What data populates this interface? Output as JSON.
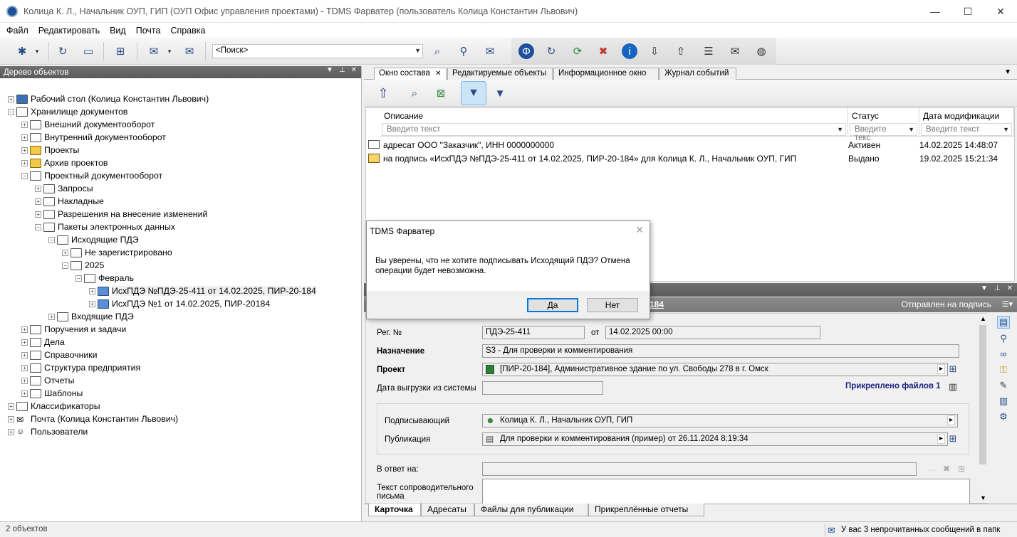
{
  "window": {
    "title": "Колица К. Л., Начальник ОУП, ГИП (ОУП Офис управления проектами) - TDMS Фарватер (пользователь Колица Константин Львович)",
    "minimize": "—",
    "maximize": "☐",
    "close": "✕"
  },
  "menu": [
    "Файл",
    "Редактировать",
    "Вид",
    "Почта",
    "Справка"
  ],
  "toolbar": {
    "search_value": "<Поиск>"
  },
  "tree_panel": {
    "title": "Дерево объектов",
    "items": [
      {
        "label": "Рабочий стол (Колица Константин Львович)",
        "level": 0,
        "sign": "+"
      },
      {
        "label": "Хранилище документов",
        "level": 0,
        "sign": "−"
      },
      {
        "label": "Внешний документооборот",
        "level": 1,
        "sign": "+"
      },
      {
        "label": "Внутренний документооборот",
        "level": 1,
        "sign": "+"
      },
      {
        "label": "Проекты",
        "level": 1,
        "sign": "+"
      },
      {
        "label": "Архив проектов",
        "level": 1,
        "sign": "+"
      },
      {
        "label": "Проектный документооборот",
        "level": 1,
        "sign": "−"
      },
      {
        "label": "Запросы",
        "level": 2,
        "sign": "+"
      },
      {
        "label": "Накладные",
        "level": 2,
        "sign": "+"
      },
      {
        "label": "Разрешения на внесение изменений",
        "level": 2,
        "sign": "+"
      },
      {
        "label": "Пакеты электронных данных",
        "level": 2,
        "sign": "−"
      },
      {
        "label": "Исходящие ПДЭ",
        "level": 3,
        "sign": "−"
      },
      {
        "label": "Не зарегистрировано",
        "level": 4,
        "sign": "+"
      },
      {
        "label": "2025",
        "level": 4,
        "sign": "−"
      },
      {
        "label": "Февраль",
        "level": 5,
        "sign": "−"
      },
      {
        "label": "ИсхПДЭ №ПДЭ-25-411 от 14.02.2025, ПИР-20-184",
        "level": 6,
        "sign": "+"
      },
      {
        "label": "ИсхПДЭ №1 от 14.02.2025, ПИР-20184",
        "level": 6,
        "sign": "+"
      },
      {
        "label": "Входящие ПДЭ",
        "level": 3,
        "sign": "+"
      },
      {
        "label": "Поручения и задачи",
        "level": 1,
        "sign": "+"
      },
      {
        "label": "Дела",
        "level": 1,
        "sign": "+"
      },
      {
        "label": "Справочники",
        "level": 1,
        "sign": "+"
      },
      {
        "label": "Структура предприятия",
        "level": 1,
        "sign": "+"
      },
      {
        "label": "Отчеты",
        "level": 1,
        "sign": "+"
      },
      {
        "label": "Шаблоны",
        "level": 1,
        "sign": "+"
      },
      {
        "label": "Классификаторы",
        "level": 0,
        "sign": "+"
      },
      {
        "label": "Почта (Колица Константин Львович)",
        "level": 0,
        "sign": "+"
      },
      {
        "label": "Пользователи",
        "level": 0,
        "sign": "+"
      }
    ]
  },
  "tabs": [
    "Окно состава",
    "Редактируемые объекты",
    "Информационное окно",
    "Журнал событий"
  ],
  "grid": {
    "columns": [
      {
        "caption": "Описание",
        "filter": "Введите текст"
      },
      {
        "caption": "Статус",
        "filter": "Введите текс"
      },
      {
        "caption": "Дата модификации",
        "filter": "Введите текст"
      }
    ],
    "rows": [
      {
        "desc": "адресат ООО \"Заказчик\", ИНН 0000000000",
        "status": "Активен",
        "date": "14.02.2025 14:48:07"
      },
      {
        "desc": "на подпись «ИсхПДЭ №ПДЭ-25-411 от 14.02.2025, ПИР-20-184» для Колица К. Л., Начальник ОУП, ГИП",
        "status": "Выдано",
        "date": "19.02.2025 15:21:34"
      }
    ]
  },
  "dialog": {
    "title": "TDMS Фарватер",
    "close": "✕",
    "message_line1": "Вы уверены, что не хотите подписывать Исходящий ПДЭ? Отмена",
    "message_line2": "операции будет невозможна.",
    "yes": "Да",
    "no": "Нет"
  },
  "card": {
    "number_fragment": "184",
    "status": "Отправлен на подпись",
    "reg_label": "Рег. №",
    "reg_value": "ПДЭ-25-411",
    "from_label": "от",
    "from_value": "14.02.2025 00:00",
    "purpose_label": "Назначение",
    "purpose_value": "S3 - Для проверки и комментирования",
    "project_label": "Проект",
    "project_value": "[ПИР-20-184], Административное здание по ул. Свободы 278 в г. Омск",
    "export_label": "Дата выгрузки из системы",
    "attached_files": "Прикреплено файлов 1",
    "signer_label": "Подписывающий",
    "signer_value": "Колица К. Л., Начальник ОУП, ГИП",
    "publication_label": "Публикация",
    "publication_value": "Для проверки и комментирования (пример) от 26.11.2024 8:19:34",
    "reply_label": "В ответ на:",
    "letter_label_1": "Текст сопроводительного",
    "letter_label_2": "письма"
  },
  "card_tabs": [
    "Карточка",
    "Адресаты",
    "Файлы для публикации",
    "Прикреплённые отчеты"
  ],
  "status": {
    "left": "2 объектов",
    "right": "У вас 3 непрочитанных сообщений в папк"
  }
}
